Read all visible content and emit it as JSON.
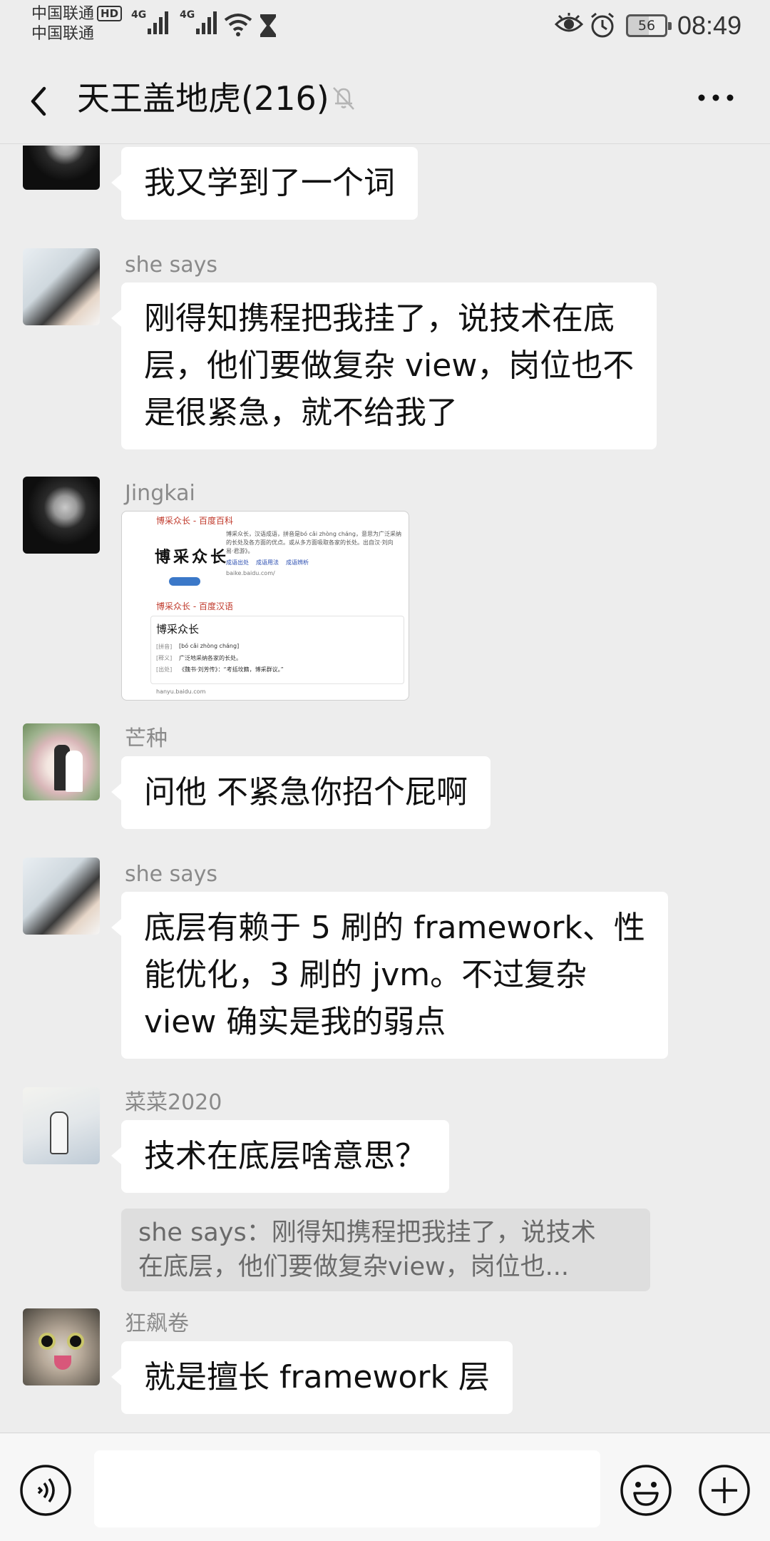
{
  "status_bar": {
    "carrier_1": "中国联通",
    "hd_badge": "HD",
    "carrier_2": "中国联通",
    "signal_1_label": "4G",
    "signal_2_label": "4G",
    "battery": "56",
    "time": "08:49"
  },
  "header": {
    "title": "天王盖地虎(216)",
    "muted": true
  },
  "messages": [
    {
      "sender": "",
      "lines": [
        "我又学到了一个词"
      ]
    },
    {
      "sender": "she says",
      "lines": [
        "刚得知携程把我挂了，说技术在底",
        "层，他们要做复杂 view，岗位也不",
        "是很紧急，就不给我了"
      ]
    },
    {
      "sender": "Jingkai",
      "type": "image"
    },
    {
      "sender": "芒种",
      "lines": [
        "问他 不紧急你招个屁啊"
      ]
    },
    {
      "sender": "she says",
      "lines": [
        "底层有赖于 5 刷的 framework、性",
        "能优化，3 刷的 jvm。不过复杂",
        "view 确实是我的弱点"
      ]
    },
    {
      "sender": "菜菜2020",
      "lines": [
        "技术在底层啥意思？"
      ],
      "quote_lines": [
        "she says：刚得知携程把我挂了，说技术",
        "在底层，他们要做复杂view，岗位也..."
      ]
    },
    {
      "sender": "狂飙卷",
      "lines": [
        "就是擅长 framework 层"
      ]
    }
  ],
  "image_card": {
    "result_1_title": "博采众长 - 百度百科",
    "result_1_logo": "博采众长",
    "result_1_desc_1": "博采众长，汉语成语，拼音是bó cǎi zhòng cháng，意思为广泛采纳",
    "result_1_desc_2": "的长处及各方面的优点。或从多方面吸取各家的长处。出自汉·刘向",
    "result_1_desc_3": "易·君游》。",
    "result_1_links": [
      "成语出处",
      "成语用法",
      "成语辨析"
    ],
    "result_1_url": "baike.baidu.com/",
    "result_2_title": "博采众长 - 百度汉语",
    "result_2_word": "博采众长",
    "result_2_pinyin_label": "[拼音]",
    "result_2_pinyin": "[bó cǎi zhòng cháng]",
    "result_2_meaning_label": "[释义]",
    "result_2_meaning": "广泛地采纳各家的长处。",
    "result_2_source_label": "[出处]",
    "result_2_source": "《魏书·刘芳传》：“考括坟籍，博采群议。”",
    "result_2_url": "hanyu.baidu.com"
  },
  "input": {
    "placeholder": ""
  },
  "colors": {
    "background": "#EDEDED",
    "bubble": "#FFFFFF",
    "sender_name": "#8A8A8A",
    "quote_bg": "#DEDEDE",
    "link_red": "#C0392B",
    "link_blue": "#2A4DB0"
  }
}
